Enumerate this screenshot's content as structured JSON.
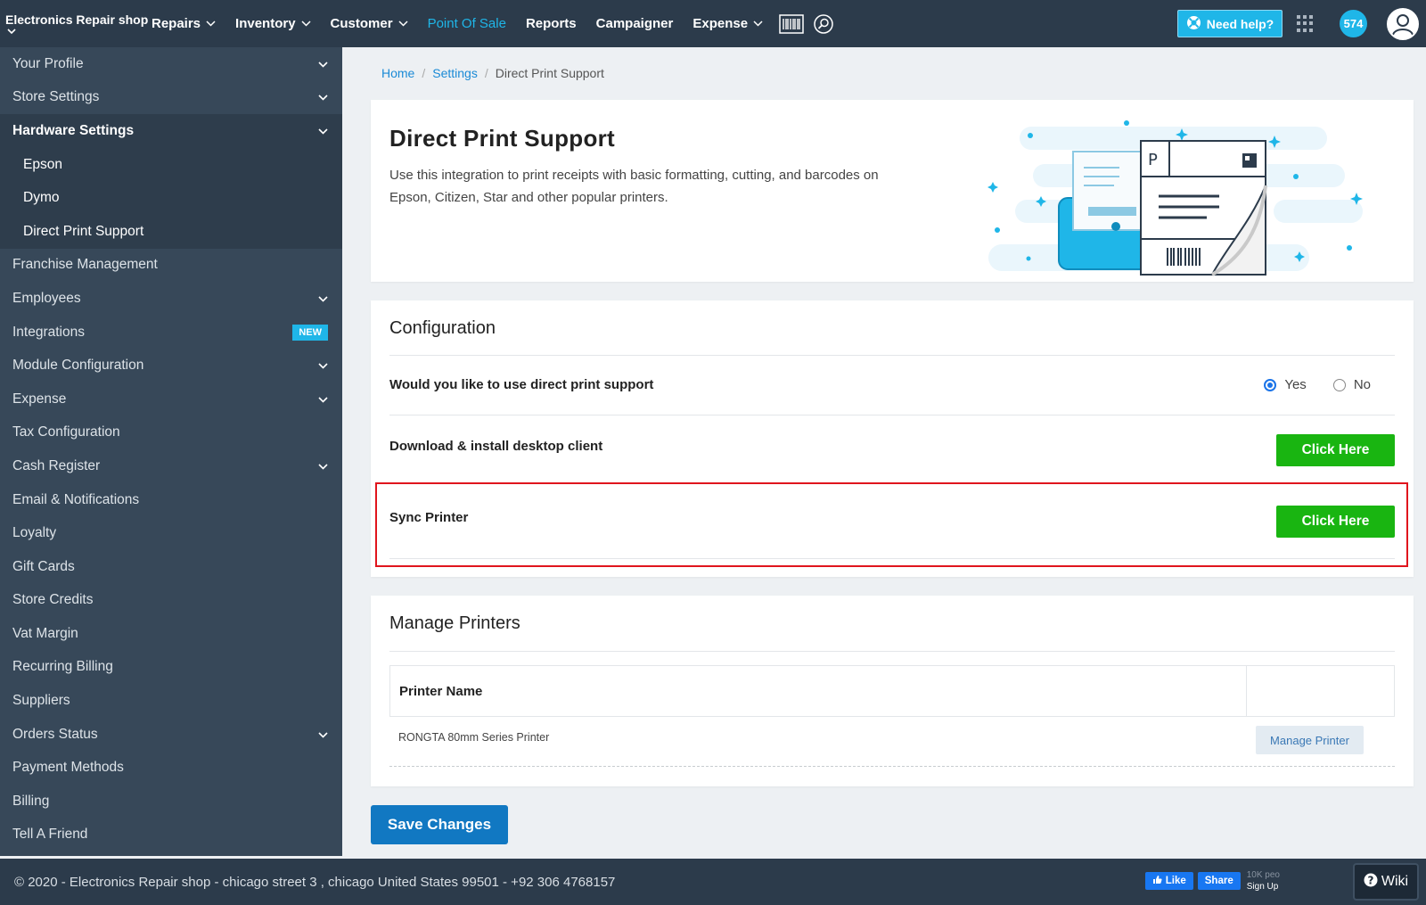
{
  "topbar": {
    "brand": "Electronics Repair shop",
    "nav": [
      {
        "label": "Repairs",
        "dropdown": true,
        "active": false
      },
      {
        "label": "Inventory",
        "dropdown": true,
        "active": false
      },
      {
        "label": "Customer",
        "dropdown": true,
        "active": false
      },
      {
        "label": "Point Of Sale",
        "dropdown": false,
        "active": true
      },
      {
        "label": "Reports",
        "dropdown": false,
        "active": false
      },
      {
        "label": "Campaigner",
        "dropdown": false,
        "active": false
      },
      {
        "label": "Expense",
        "dropdown": true,
        "active": false
      }
    ],
    "help_label": "Need help?",
    "notification_count": "574"
  },
  "sidebar": {
    "items": [
      {
        "label": "Your Profile",
        "chevron": true
      },
      {
        "label": "Store Settings",
        "chevron": true
      },
      {
        "label": "Hardware Settings",
        "chevron": true,
        "expanded": true
      },
      {
        "label": "Epson",
        "sub": true
      },
      {
        "label": "Dymo",
        "sub": true
      },
      {
        "label": "Direct Print Support",
        "sub": true,
        "active": true
      },
      {
        "label": "Franchise Management"
      },
      {
        "label": "Employees",
        "chevron": true
      },
      {
        "label": "Integrations",
        "badge": "NEW"
      },
      {
        "label": "Module Configuration",
        "chevron": true
      },
      {
        "label": "Expense",
        "chevron": true
      },
      {
        "label": "Tax Configuration"
      },
      {
        "label": "Cash Register",
        "chevron": true
      },
      {
        "label": "Email & Notifications"
      },
      {
        "label": "Loyalty"
      },
      {
        "label": "Gift Cards"
      },
      {
        "label": "Store Credits"
      },
      {
        "label": "Vat Margin"
      },
      {
        "label": "Recurring Billing"
      },
      {
        "label": "Suppliers"
      },
      {
        "label": "Orders Status",
        "chevron": true
      },
      {
        "label": "Payment Methods"
      },
      {
        "label": "Billing"
      },
      {
        "label": "Tell A Friend"
      }
    ]
  },
  "breadcrumb": {
    "home": "Home",
    "settings": "Settings",
    "current": "Direct Print Support"
  },
  "hero": {
    "title": "Direct Print Support",
    "description": "Use this integration to print receipts with basic formatting, cutting, and barcodes on Epson, Citizen, Star and other popular printers.",
    "illustration_letter": "P"
  },
  "config": {
    "title": "Configuration",
    "question": "Would you like to use direct print support",
    "yes_label": "Yes",
    "no_label": "No",
    "selected": "Yes",
    "download_label": "Download & install desktop client",
    "download_button": "Click Here",
    "sync_label": "Sync Printer",
    "sync_button": "Click Here"
  },
  "printers": {
    "title": "Manage Printers",
    "column_header": "Printer Name",
    "rows": [
      {
        "name": "RONGTA 80mm Series Printer",
        "action": "Manage Printer"
      }
    ]
  },
  "save_button": "Save Changes",
  "footer": {
    "text": "© 2020 - Electronics Repair shop - chicago street 3 , chicago United States 99501 - +92 306 4768157",
    "fb_like": "Like",
    "fb_share": "Share",
    "fb_count": "10K peo",
    "fb_signup": "Sign Up",
    "wiki": "Wiki"
  },
  "colors": {
    "nav_bg": "#2c3b4b",
    "sidebar_bg": "#374859",
    "accent": "#1fb6e8",
    "green": "#19b511",
    "primary": "#1178c2",
    "highlight": "#e0151d"
  }
}
